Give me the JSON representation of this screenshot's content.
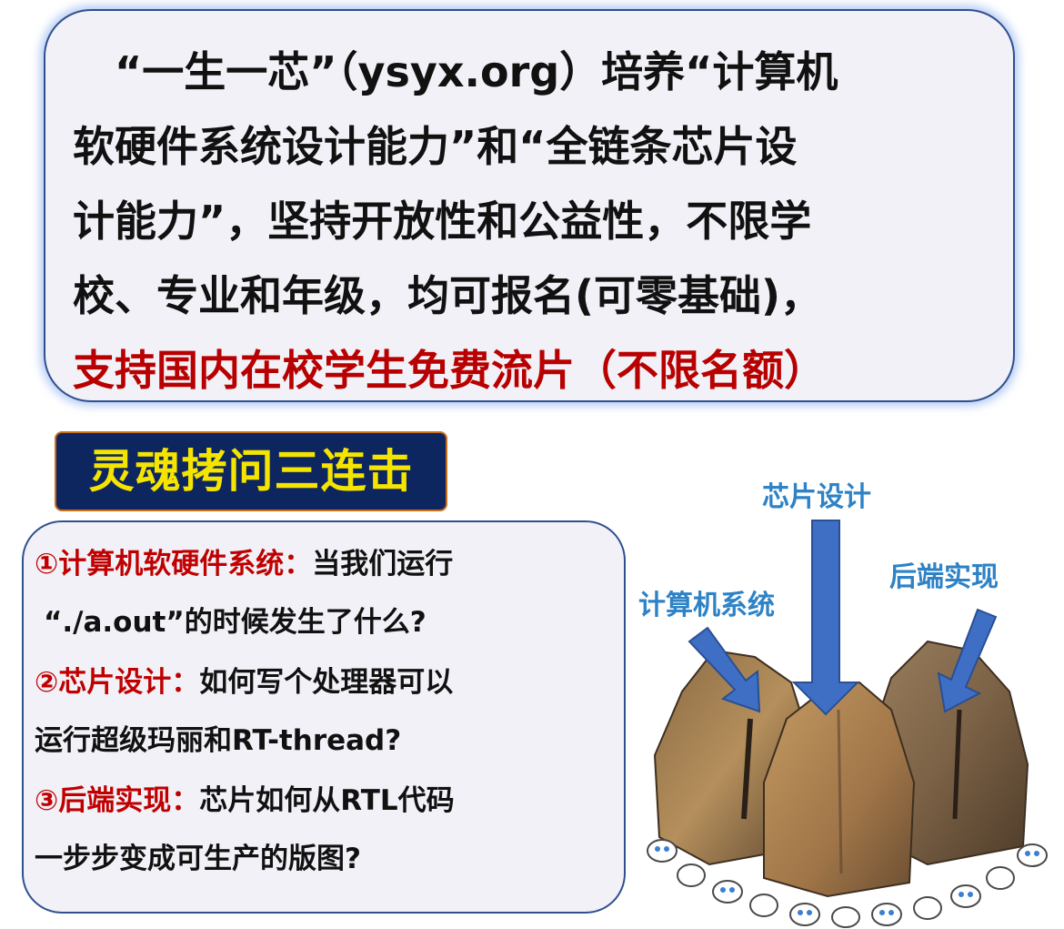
{
  "intro": {
    "line1": "“一生一芯”（ysyx.org）培养“计算机",
    "line2": "软硬件系统设计能力”和“全链条芯片设",
    "line3": "计能力”，坚持开放性和公益性，不限学",
    "line4": "校、专业和年级，均可报名(可零基础)，",
    "line5": "支持国内在校学生免费流片（不限名额）"
  },
  "title": "灵魂拷问三连击",
  "questions": [
    {
      "key": "①计算机软硬件系统：",
      "text1": "当我们运行",
      "text2": "“./a.out”的时候发生了什么?"
    },
    {
      "key": "②芯片设计：",
      "text1": "如何写个处理器可以",
      "text2": "运行超级玛丽和RT-thread?"
    },
    {
      "key": "③后端实现：",
      "text1": "芯片如何从RTL代码",
      "text2": "一步步变成可生产的版图?"
    }
  ],
  "illustration": {
    "labels": [
      "芯片设计",
      "后端实现",
      "计算机系统"
    ],
    "colors": {
      "label": "#2e82c6",
      "arrow": "#3f6fc4",
      "rock": "#b08a55"
    }
  }
}
